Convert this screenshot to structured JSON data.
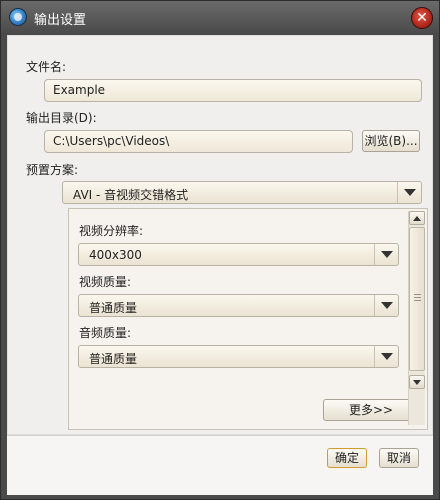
{
  "window": {
    "title": "输出设置",
    "close_glyph": "✕"
  },
  "form": {
    "filename_label": "文件名:",
    "filename_value": "Example",
    "output_dir_label": "输出目录(D):",
    "output_dir_value": "C:\\Users\\pc\\Videos\\",
    "browse_label": "浏览(B)...",
    "preset_label": "预置方案:",
    "preset_value": "AVI - 音视频交错格式"
  },
  "settings": {
    "resolution_label": "视频分辨率:",
    "resolution_value": "400x300",
    "video_quality_label": "视频质量:",
    "video_quality_value": "普通质量",
    "audio_quality_label": "音频质量:",
    "audio_quality_value": "普通质量",
    "more_label": "更多>>"
  },
  "footer": {
    "ok_label": "确定",
    "cancel_label": "取消"
  },
  "icons": {
    "app": "app-icon",
    "close": "close-icon",
    "dropdown": "chevron-down-icon",
    "scroll_up": "scroll-up-icon",
    "scroll_down": "scroll-down-icon"
  }
}
